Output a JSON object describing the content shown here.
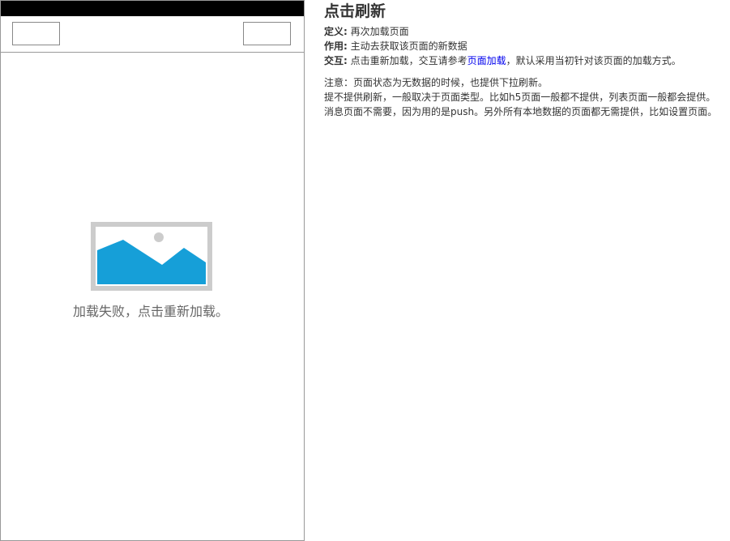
{
  "phone": {
    "error_message": "加载失败，点击重新加载。",
    "image_icon": "image-placeholder-icon",
    "colors": {
      "status_bar": "#000000",
      "image_fill": "#169fd8",
      "image_frame": "#cccccc"
    }
  },
  "notes": {
    "title": "点击刷新",
    "definition": {
      "label": "定义:",
      "text": "再次加载页面"
    },
    "purpose": {
      "label": "作用:",
      "text": "主动去获取该页面的新数据"
    },
    "interaction": {
      "label": "交互:",
      "text_before": "点击重新加载，交互请参考",
      "link": "页面加载",
      "text_after": "，默认采用当初针对该页面的加载方式。"
    },
    "remark_1": "注意：页面状态为无数据的时候，也提供下拉刷新。",
    "remark_2": "提不提供刷新，一般取决于页面类型。比如h5页面一般都不提供，列表页面一般都会提供。",
    "remark_3": "消息页面不需要，因为用的是push。另外所有本地数据的页面都无需提供，比如设置页面。",
    "link_color": "#0000ee"
  }
}
